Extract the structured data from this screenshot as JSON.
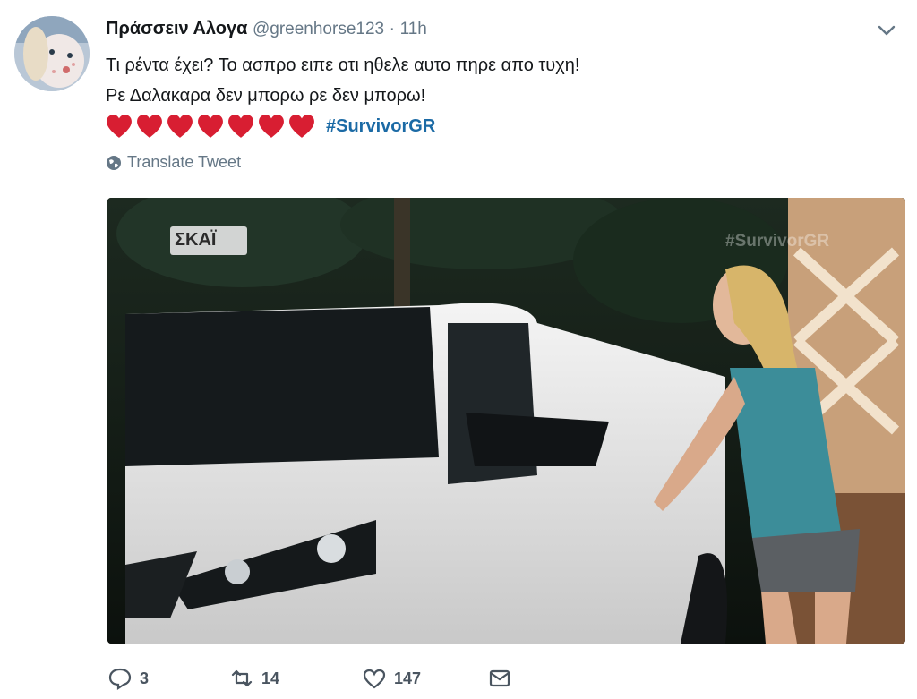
{
  "tweet": {
    "display_name": "Πράσσειν Αλογα",
    "handle": "@greenhorse123",
    "separator": "·",
    "time": "11h",
    "line1": "Τι ρέντα έχει? Το ασπρο ειπε οτι ηθελε αυτο πηρε απο τυχη!",
    "line2": "Ρε Δαλακαρα δεν μπορω ρε δεν μπορω!",
    "heart_count": 7,
    "hashtag": "#SurvivorGR",
    "translate_label": "Translate Tweet"
  },
  "media": {
    "channel_logo": "ΣΚΑΪ",
    "watermark": "#SurvivorGR"
  },
  "actions": {
    "reply_count": "3",
    "retweet_count": "14",
    "like_count": "147"
  },
  "colors": {
    "accent": "#1b6aa5",
    "heart": "#d81e32",
    "muted": "#657786"
  },
  "icons": [
    "chevron-down-icon",
    "globe-icon",
    "reply-icon",
    "retweet-icon",
    "like-icon",
    "direct-message-icon",
    "heart-emoji"
  ]
}
